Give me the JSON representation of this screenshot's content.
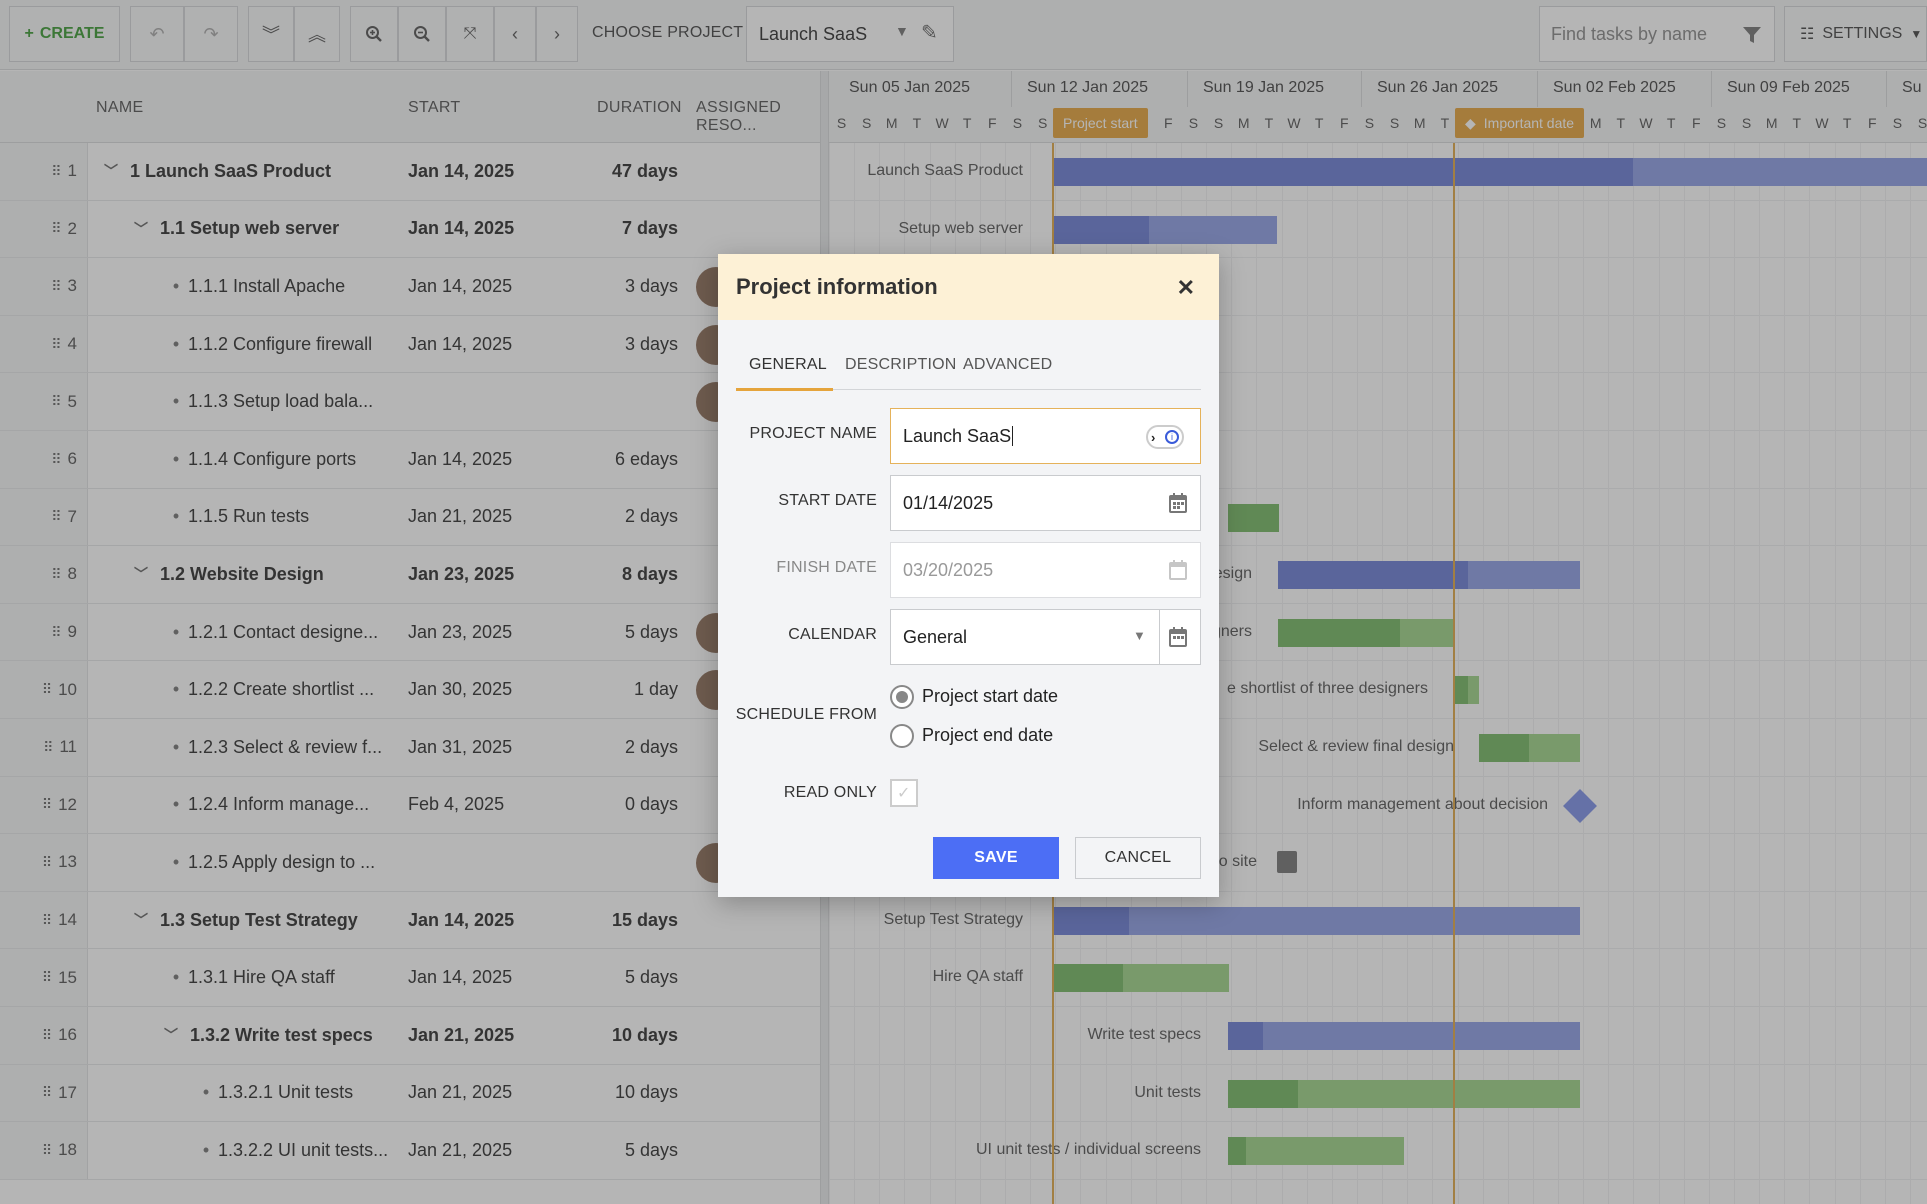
{
  "toolbar": {
    "create_label": "CREATE",
    "choose_project_label": "CHOOSE PROJECT",
    "project_value": "Launch SaaS",
    "find_placeholder": "Find tasks by name",
    "settings_label": "SETTINGS"
  },
  "grid": {
    "columns": {
      "name": "NAME",
      "start": "START",
      "duration": "DURATION",
      "resources": "ASSIGNED RESO..."
    },
    "rows": [
      {
        "id": "1",
        "name": "1 Launch SaaS Product",
        "start": "Jan 14, 2025",
        "duration": "47 days"
      },
      {
        "id": "2",
        "name": "1.1 Setup web server",
        "start": "Jan 14, 2025",
        "duration": "7 days"
      },
      {
        "id": "3",
        "name": "1.1.1 Install Apache",
        "start": "Jan 14, 2025",
        "duration": "3 days"
      },
      {
        "id": "4",
        "name": "1.1.2 Configure firewall",
        "start": "Jan 14, 2025",
        "duration": "3 days"
      },
      {
        "id": "5",
        "name": "1.1.3 Setup load bala...",
        "start": "",
        "duration": ""
      },
      {
        "id": "6",
        "name": "1.1.4 Configure ports",
        "start": "Jan 14, 2025",
        "duration": "6 edays"
      },
      {
        "id": "7",
        "name": "1.1.5 Run tests",
        "start": "Jan 21, 2025",
        "duration": "2 days"
      },
      {
        "id": "8",
        "name": "1.2 Website Design",
        "start": "Jan 23, 2025",
        "duration": "8 days"
      },
      {
        "id": "9",
        "name": "1.2.1 Contact designe...",
        "start": "Jan 23, 2025",
        "duration": "5 days"
      },
      {
        "id": "10",
        "name": "1.2.2 Create shortlist ...",
        "start": "Jan 30, 2025",
        "duration": "1 day"
      },
      {
        "id": "11",
        "name": "1.2.3 Select & review f...",
        "start": "Jan 31, 2025",
        "duration": "2 days"
      },
      {
        "id": "12",
        "name": "1.2.4 Inform manage...",
        "start": "Feb 4, 2025",
        "duration": "0 days"
      },
      {
        "id": "13",
        "name": "1.2.5 Apply design to ...",
        "start": "",
        "duration": ""
      },
      {
        "id": "14",
        "name": "1.3 Setup Test Strategy",
        "start": "Jan 14, 2025",
        "duration": "15 days"
      },
      {
        "id": "15",
        "name": "1.3.1 Hire QA staff",
        "start": "Jan 14, 2025",
        "duration": "5 days"
      },
      {
        "id": "16",
        "name": "1.3.2 Write test specs",
        "start": "Jan 21, 2025",
        "duration": "10 days"
      },
      {
        "id": "17",
        "name": "1.3.2.1 Unit tests",
        "start": "Jan 21, 2025",
        "duration": "10 days"
      },
      {
        "id": "18",
        "name": "1.3.2.2 UI unit tests...",
        "start": "Jan 21, 2025",
        "duration": "5 days"
      }
    ]
  },
  "timeline": {
    "weeks": [
      "Sun 05 Jan 2025",
      "Sun 12 Jan 2025",
      "Sun 19 Jan 2025",
      "Sun 26 Jan 2025",
      "Sun 02 Feb 2025",
      "Sun 09 Feb 2025",
      "Su"
    ],
    "day_letters": [
      "S",
      "M",
      "T",
      "W",
      "T",
      "F",
      "S"
    ],
    "flags": {
      "project_start": "Project start",
      "important_date": "Important date"
    },
    "labels": {
      "r1": "Launch SaaS Product",
      "r2": "Setup web server",
      "r8": "esign",
      "r9": "gners",
      "r10": "e shortlist of three designers",
      "r11": "Select & review final design",
      "r12": "Inform management about decision",
      "r13": "o site",
      "r14": "Setup Test Strategy",
      "r15": "Hire QA staff",
      "r16": "Write test specs",
      "r17": "Unit tests",
      "r18": "UI unit tests / individual screens"
    }
  },
  "dialog": {
    "title": "Project information",
    "tabs": [
      "GENERAL",
      "DESCRIPTION",
      "ADVANCED"
    ],
    "fields": {
      "project_name_label": "PROJECT NAME",
      "project_name_value": "Launch SaaS",
      "start_date_label": "START DATE",
      "start_date_value": "01/14/2025",
      "finish_date_label": "FINISH DATE",
      "finish_date_value": "03/20/2025",
      "calendar_label": "CALENDAR",
      "calendar_value": "General",
      "schedule_from_label": "SCHEDULE FROM",
      "schedule_options": [
        "Project start date",
        "Project end date"
      ],
      "read_only_label": "READ ONLY"
    },
    "save_label": "SAVE",
    "cancel_label": "CANCEL"
  },
  "colors": {
    "accent_orange": "#e5a43c",
    "primary_blue": "#4c6ef5",
    "parent_bar": "#8e9ee6",
    "leaf_bar": "#9fd388",
    "create_green": "#3d9b35"
  }
}
